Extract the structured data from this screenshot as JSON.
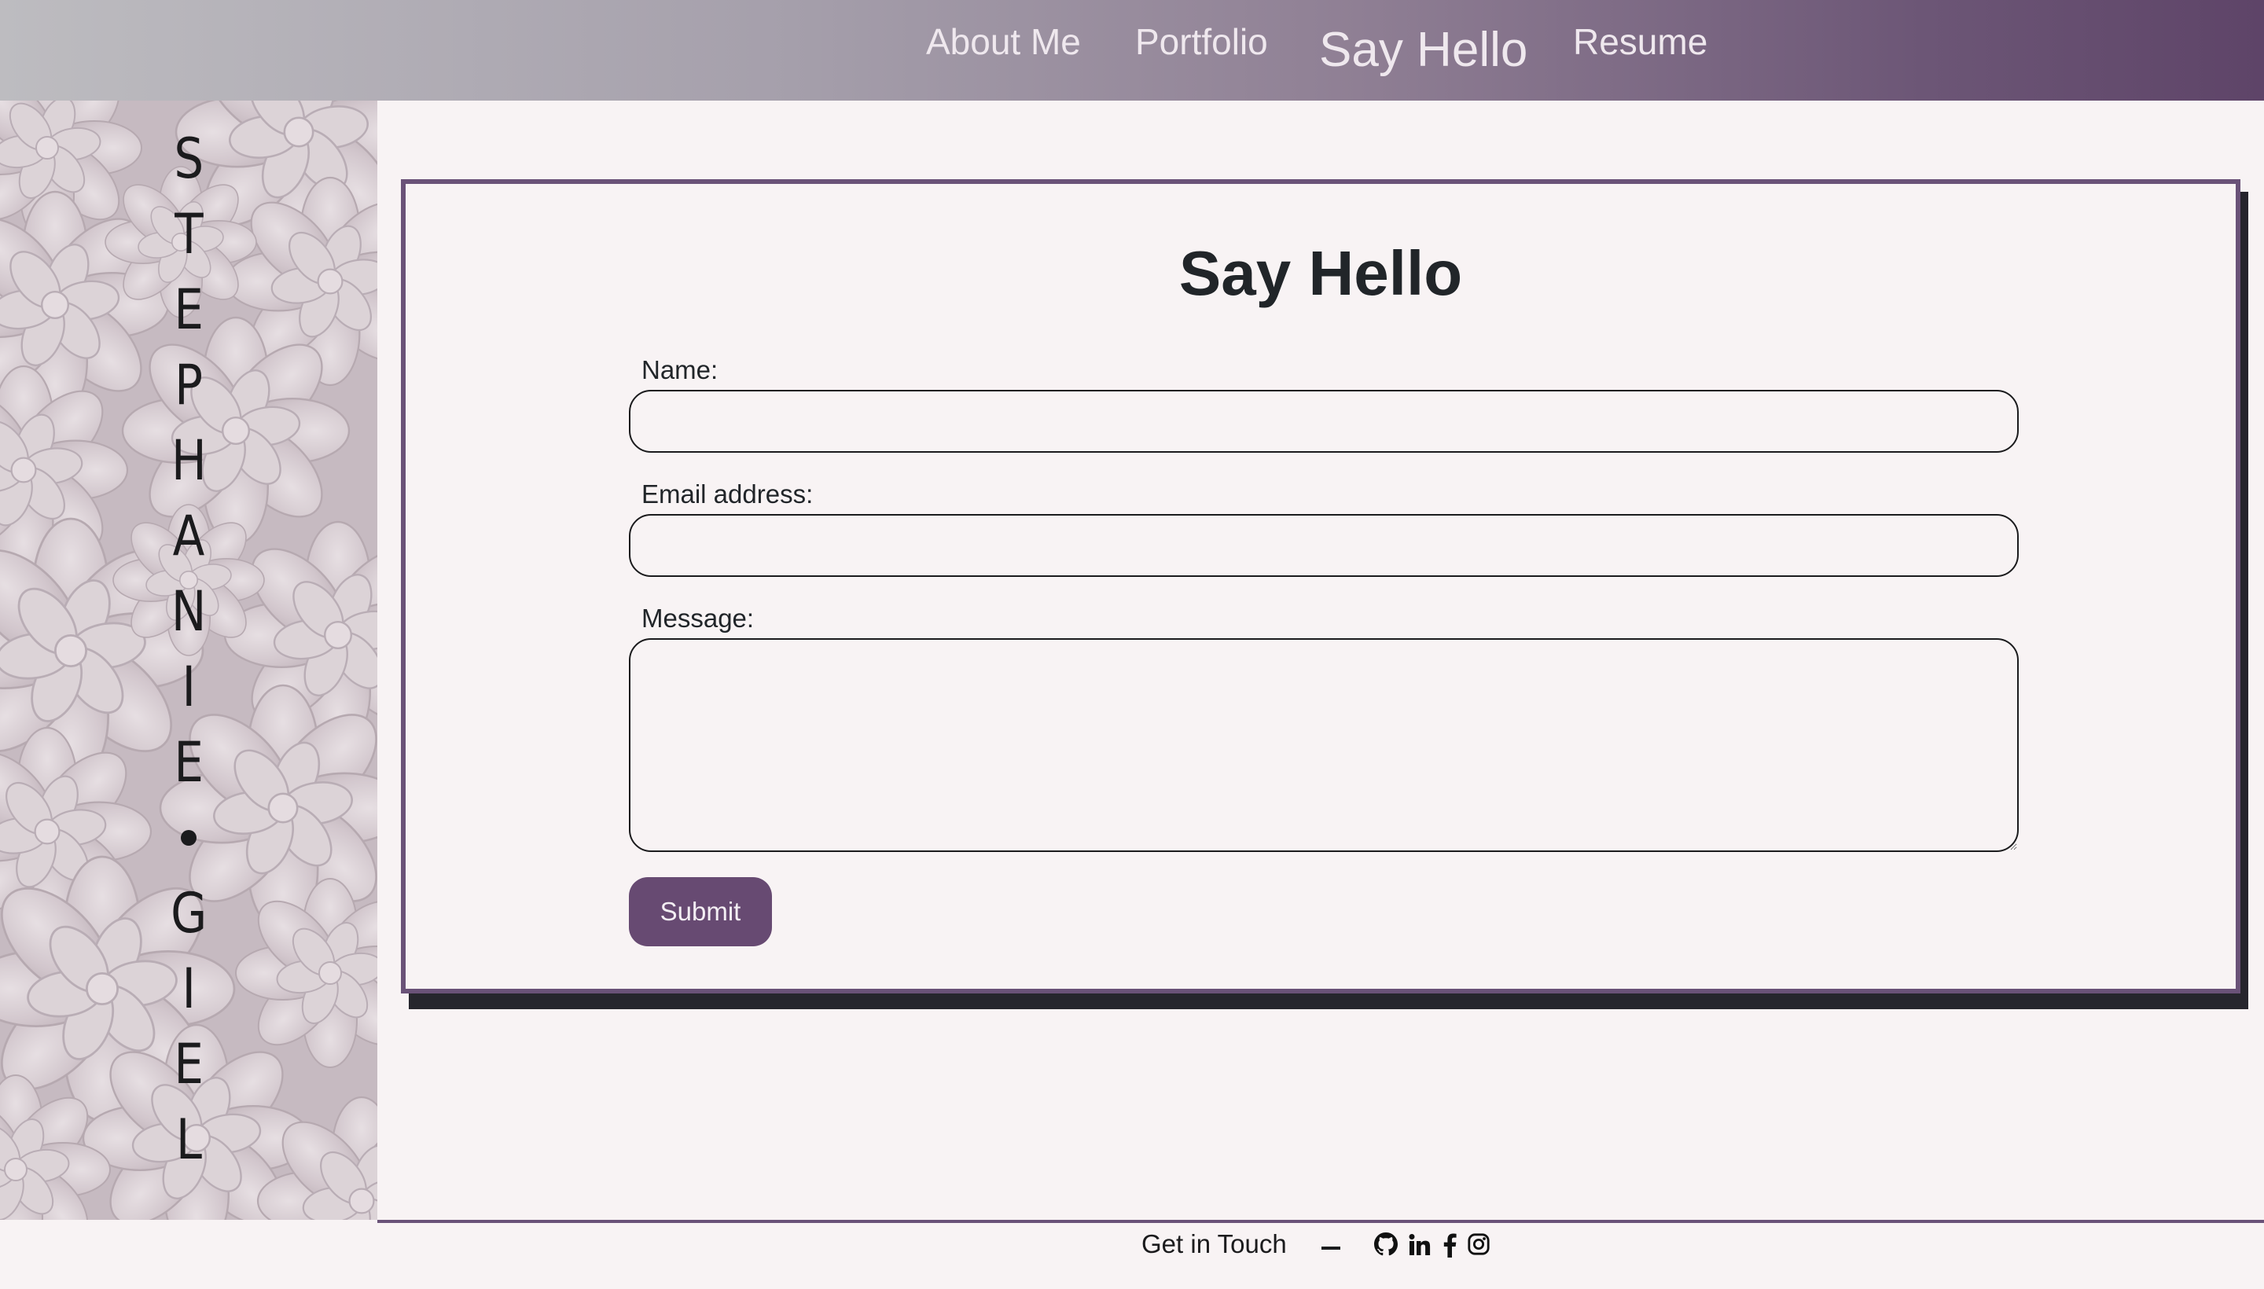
{
  "nav": {
    "items": [
      {
        "label": "About Me"
      },
      {
        "label": "Portfolio"
      },
      {
        "label": "Say Hello",
        "active": true
      },
      {
        "label": "Resume"
      }
    ]
  },
  "sidebar": {
    "name_letters": [
      "S",
      "T",
      "E",
      "P",
      "H",
      "A",
      "N",
      "I",
      "E",
      "•",
      "G",
      "I",
      "E",
      "L"
    ],
    "first_letters": [
      "S",
      "T",
      "E",
      "P",
      "H",
      "A",
      "N",
      "I",
      "E"
    ],
    "last_letters": [
      "G",
      "I",
      "E",
      "L"
    ]
  },
  "form": {
    "title": "Say Hello",
    "name_label": "Name:",
    "email_label": "Email address:",
    "message_label": "Message:",
    "name_value": "",
    "email_value": "",
    "message_value": "",
    "submit_label": "Submit"
  },
  "footer": {
    "text": "Get in Touch",
    "icons": [
      "github-icon",
      "linkedin-icon",
      "facebook-icon",
      "instagram-icon"
    ]
  },
  "colors": {
    "accent": "#674a72",
    "border": "#6a5278",
    "background": "#f8f3f4",
    "shadow": "#26262d"
  }
}
